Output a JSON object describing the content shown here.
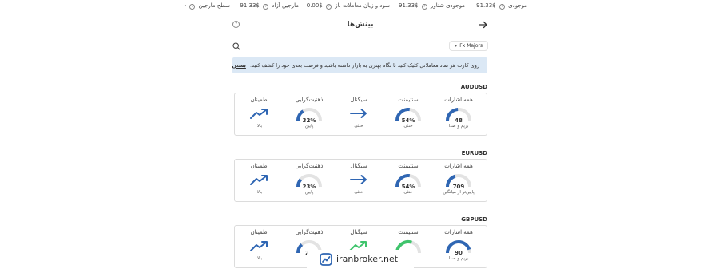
{
  "topbar": {
    "stats": [
      {
        "label": "موجودی",
        "value": "$91.33"
      },
      {
        "label": "موجودی شناور",
        "value": "$91.33"
      },
      {
        "label": "سود و زیان معاملات باز",
        "value": "$0.00"
      },
      {
        "label": "مارجین آزاد",
        "value": "$91.33"
      },
      {
        "label": "سطح مارجین",
        "value": "-"
      }
    ]
  },
  "header": {
    "title": "بینش‌ها",
    "back_icon": "arrow-right-icon",
    "help_icon": "help-circle-icon",
    "help_glyph": "?"
  },
  "toolbar": {
    "dropdown_label": "Fx Majors",
    "search_icon": "search-icon"
  },
  "banner": {
    "text": "روی کارت هر نماد معاملاتی کلیک کنید تا نگاه بهتری به بازار داشته باشید و فرصت بعدی خود را کشف کنید.",
    "close_label": "بستن"
  },
  "colors": {
    "blue": "#2f66b3",
    "green": "#3fc46c",
    "track": "#e3e3e3",
    "banner": "#dbe8f5"
  },
  "cards": [
    {
      "symbol": "AUDUSD",
      "all_signals": {
        "label": "همه اشارات",
        "value": "48",
        "sub": "بریم و صدا",
        "level": 0.48,
        "color": "#2f66b3"
      },
      "sentiment": {
        "label": "سنتیمنت",
        "value": "54%",
        "sub": "خنثی",
        "level": 0.54,
        "color": "#2f66b3"
      },
      "signal": {
        "label": "سیگنال",
        "sub": "خنثی",
        "glyph": "arrow-right-icon",
        "color": "#2f66b3"
      },
      "mindset": {
        "label": "ذهنیت‌گرایی",
        "value": "32%",
        "sub": "پایین",
        "level": 0.32,
        "color": "#2f66b3"
      },
      "confidence": {
        "label": "اطمینان",
        "sub": "بالا",
        "glyph": "trend-up-icon",
        "color": "#2f66b3"
      }
    },
    {
      "symbol": "EURUSD",
      "all_signals": {
        "label": "همه اشارات",
        "value": "709",
        "sub": "پایین‌تر از میانگین",
        "level": 0.4,
        "color": "#2f66b3"
      },
      "sentiment": {
        "label": "سنتیمنت",
        "value": "54%",
        "sub": "خنثی",
        "level": 0.54,
        "color": "#2f66b3"
      },
      "signal": {
        "label": "سیگنال",
        "sub": "خنثی",
        "glyph": "arrow-right-icon",
        "color": "#2f66b3"
      },
      "mindset": {
        "label": "ذهنیت‌گرایی",
        "value": "23%",
        "sub": "پایین",
        "level": 0.23,
        "color": "#2f66b3"
      },
      "confidence": {
        "label": "اطمینان",
        "sub": "بالا",
        "glyph": "trend-up-icon",
        "color": "#2f66b3"
      }
    },
    {
      "symbol": "GBPUSD",
      "all_signals": {
        "label": "همه اشارات",
        "value": "90",
        "sub": "بریم و صدا",
        "level": 0.9,
        "color": "#2f66b3"
      },
      "sentiment": {
        "label": "سنتیمنت",
        "value": "",
        "sub": "",
        "level": 0.6,
        "color": "#3fc46c"
      },
      "signal": {
        "label": "سیگنال",
        "sub": "",
        "glyph": "trend-up-icon",
        "color": "#3fc46c"
      },
      "mindset": {
        "label": "ذهنیت‌گرایی",
        "value": "27",
        "sub": "",
        "level": 0.27,
        "color": "#2f66b3"
      },
      "confidence": {
        "label": "اطمینان",
        "sub": "بالا",
        "glyph": "trend-up-icon",
        "color": "#2f66b3"
      }
    }
  ],
  "watermark": {
    "text": "iranbroker.net",
    "logo": "chart-logo-icon"
  }
}
